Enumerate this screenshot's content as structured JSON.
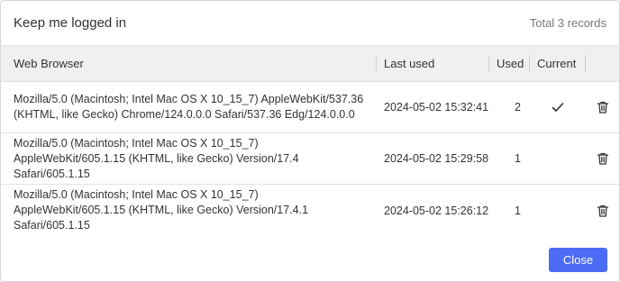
{
  "dialog": {
    "title": "Keep me logged in",
    "total": "Total 3 records",
    "close_label": "Close"
  },
  "table": {
    "headers": {
      "browser": "Web Browser",
      "last_used": "Last used",
      "used": "Used",
      "current": "Current"
    },
    "rows": [
      {
        "browser": "Mozilla/5.0 (Macintosh; Intel Mac OS X 10_15_7) AppleWebKit/537.36 (KHTML, like Gecko) Chrome/124.0.0.0 Safari/537.36 Edg/124.0.0.0",
        "last_used": "2024-05-02 15:32:41",
        "used": "2",
        "current": true
      },
      {
        "browser": "Mozilla/5.0 (Macintosh; Intel Mac OS X 10_15_7) AppleWebKit/605.1.15 (KHTML, like Gecko) Version/17.4 Safari/605.1.15",
        "last_used": "2024-05-02 15:29:58",
        "used": "1",
        "current": false
      },
      {
        "browser": "Mozilla/5.0 (Macintosh; Intel Mac OS X 10_15_7) AppleWebKit/605.1.15 (KHTML, like Gecko) Version/17.4.1 Safari/605.1.15",
        "last_used": "2024-05-02 15:26:12",
        "used": "1",
        "current": false
      }
    ]
  },
  "icons": {
    "current": "checkmark-icon",
    "delete": "trash-icon"
  },
  "colors": {
    "accent": "#4d6cf5",
    "header_bg": "#f0f0f0",
    "border": "#e2e2e2"
  }
}
